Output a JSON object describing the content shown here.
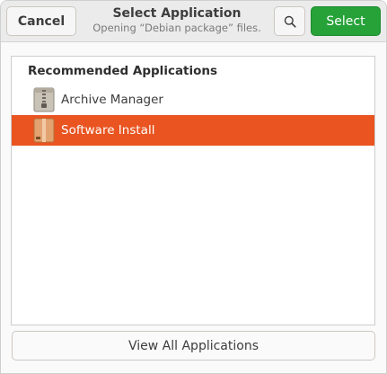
{
  "header": {
    "cancel_label": "Cancel",
    "title": "Select Application",
    "subtitle": "Opening “Debian package” files.",
    "search_icon": "search-icon",
    "select_label": "Select"
  },
  "list": {
    "heading": "Recommended Applications",
    "items": [
      {
        "label": "Archive Manager",
        "icon": "archive-manager-icon",
        "selected": false
      },
      {
        "label": "Software Install",
        "icon": "software-install-icon",
        "selected": true
      }
    ]
  },
  "footer": {
    "view_all_label": "View All Applications"
  },
  "colors": {
    "accent_selected_row": "#e95420",
    "select_button": "#26a239"
  }
}
